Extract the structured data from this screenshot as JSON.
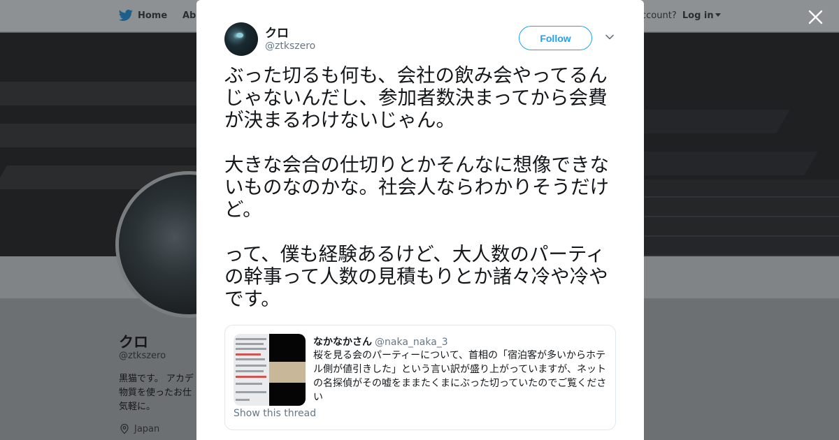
{
  "topbar": {
    "home_label": "Home",
    "about_label": "Abo",
    "account_prompt": "ccount?",
    "login_label": "Log in"
  },
  "background_profile": {
    "name": "クロ",
    "handle": "@ztkszero",
    "bio": "黒猫です。 アカデ物質を使ったお仕気軽に。",
    "location": "Japan"
  },
  "tweet": {
    "author_name": "クロ",
    "author_handle": "@ztkszero",
    "follow_label": "Follow",
    "paragraphs": [
      "ぶった切るも何も、会社の飲み会やってるんじゃないんだし、参加者数決まってから会費が決まるわけないじゃん。",
      "大きな会合の仕切りとかそんなに想像できないものなのかな。社会人ならわかりそうだけど。",
      "って、僕も経験あるけど、大人数のパーティの幹事って人数の見積もりとか諸々冷や冷やです。"
    ]
  },
  "quoted_tweet": {
    "author_name": "なかなかさん",
    "author_handle": "@naka_naka_3",
    "text": "桜を見る会のパーティーについて、首相の「宿泊客が多いからホテル側が値引きした」という言い訳が盛り上がっていますが、ネットの名探偵がその嘘をままたくまにぶった切っていたのでご覧ください",
    "show_thread_label": "Show this thread"
  },
  "colors": {
    "twitter_blue": "#1da1f2",
    "secondary_text": "#657786",
    "primary_text": "#14171a"
  },
  "icons": {
    "home": "twitter-bird-icon",
    "location": "location-pin-icon",
    "close": "close-icon",
    "menu": "chevron-down-icon"
  }
}
